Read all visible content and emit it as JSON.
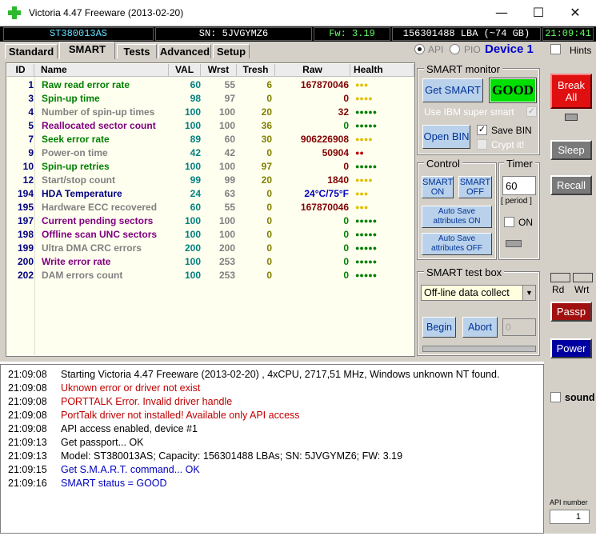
{
  "window": {
    "title": "Victoria 4.47  Freeware (2013-02-20)",
    "minimize": "—",
    "maximize": "☐",
    "close": "✕"
  },
  "infobar": {
    "model": "ST380013AS",
    "serial": "SN: 5JVGYMZ6",
    "firmware": "Fw: 3.19",
    "lba": "156301488 LBA (~74 GB)",
    "clock": "21:09:41"
  },
  "tabs": [
    "Standard",
    "SMART",
    "Tests",
    "Advanced",
    "Setup"
  ],
  "api_pio": {
    "api": "API",
    "pio": "PIO",
    "device": "Device 1",
    "hints": "Hints"
  },
  "smart_table": {
    "headers": [
      "ID",
      "Name",
      "VAL",
      "Wrst",
      "Tresh",
      "Raw",
      "Health"
    ],
    "rows": [
      {
        "id": "1",
        "name": "Raw read error rate",
        "val": "60",
        "wrst": "55",
        "tresh": "6",
        "raw": "167870046",
        "health": "●●●",
        "name_color": "#008000",
        "raw_color": "#800000",
        "health_color": "#e0c000"
      },
      {
        "id": "3",
        "name": "Spin-up time",
        "val": "98",
        "wrst": "97",
        "tresh": "0",
        "raw": "0",
        "health": "●●●●",
        "name_color": "#008000",
        "raw_color": "#800000",
        "health_color": "#e0c000"
      },
      {
        "id": "4",
        "name": "Number of spin-up times",
        "val": "100",
        "wrst": "100",
        "tresh": "20",
        "raw": "32",
        "health": "●●●●●",
        "name_color": "#808080",
        "raw_color": "#800000",
        "health_color": "#008000"
      },
      {
        "id": "5",
        "name": "Reallocated sector count",
        "val": "100",
        "wrst": "100",
        "tresh": "36",
        "raw": "0",
        "health": "●●●●●",
        "name_color": "#800080",
        "raw_color": "#008000",
        "health_color": "#008000"
      },
      {
        "id": "7",
        "name": "Seek error rate",
        "val": "89",
        "wrst": "60",
        "tresh": "30",
        "raw": "906226908",
        "health": "●●●●",
        "name_color": "#008000",
        "raw_color": "#800000",
        "health_color": "#e0c000"
      },
      {
        "id": "9",
        "name": "Power-on time",
        "val": "42",
        "wrst": "42",
        "tresh": "0",
        "raw": "50904",
        "health": "●●",
        "name_color": "#808080",
        "raw_color": "#800000",
        "health_color": "#c00000"
      },
      {
        "id": "10",
        "name": "Spin-up retries",
        "val": "100",
        "wrst": "100",
        "tresh": "97",
        "raw": "0",
        "health": "●●●●●",
        "name_color": "#008000",
        "raw_color": "#800000",
        "health_color": "#008000"
      },
      {
        "id": "12",
        "name": "Start/stop count",
        "val": "99",
        "wrst": "99",
        "tresh": "20",
        "raw": "1840",
        "health": "●●●●",
        "name_color": "#808080",
        "raw_color": "#800000",
        "health_color": "#e0c000"
      },
      {
        "id": "194",
        "name": "HDA Temperature",
        "val": "24",
        "wrst": "63",
        "tresh": "0",
        "raw": "24°C/75°F",
        "health": "●●●",
        "name_color": "#000080",
        "raw_color": "#0000c0",
        "health_color": "#e0c000"
      },
      {
        "id": "195",
        "name": "Hardware ECC recovered",
        "val": "60",
        "wrst": "55",
        "tresh": "0",
        "raw": "167870046",
        "health": "●●●",
        "name_color": "#808080",
        "raw_color": "#800000",
        "health_color": "#e0c000"
      },
      {
        "id": "197",
        "name": "Current pending sectors",
        "val": "100",
        "wrst": "100",
        "tresh": "0",
        "raw": "0",
        "health": "●●●●●",
        "name_color": "#800080",
        "raw_color": "#008000",
        "health_color": "#008000"
      },
      {
        "id": "198",
        "name": "Offline scan UNC sectors",
        "val": "100",
        "wrst": "100",
        "tresh": "0",
        "raw": "0",
        "health": "●●●●●",
        "name_color": "#800080",
        "raw_color": "#008000",
        "health_color": "#008000"
      },
      {
        "id": "199",
        "name": "Ultra DMA CRC errors",
        "val": "200",
        "wrst": "200",
        "tresh": "0",
        "raw": "0",
        "health": "●●●●●",
        "name_color": "#808080",
        "raw_color": "#008000",
        "health_color": "#008000"
      },
      {
        "id": "200",
        "name": "Write error rate",
        "val": "100",
        "wrst": "253",
        "tresh": "0",
        "raw": "0",
        "health": "●●●●●",
        "name_color": "#800080",
        "raw_color": "#008000",
        "health_color": "#008000"
      },
      {
        "id": "202",
        "name": "DAM errors count",
        "val": "100",
        "wrst": "253",
        "tresh": "0",
        "raw": "0",
        "health": "●●●●●",
        "name_color": "#808080",
        "raw_color": "#008000",
        "health_color": "#008000"
      }
    ]
  },
  "smart_monitor": {
    "title": "SMART monitor",
    "get_smart": "Get SMART",
    "status": "GOOD",
    "use_ibm": "Use IBM super smart",
    "open_bin": "Open BIN",
    "save_bin": "Save BIN",
    "crypt_it": "Crypt it!"
  },
  "control": {
    "title": "Control",
    "smart_on": "SMART ON",
    "smart_off": "SMART OFF",
    "autosave_on": "Auto Save attributes ON",
    "autosave_off": "Auto Save attributes OFF"
  },
  "timer": {
    "title": "Timer",
    "value": "60",
    "period": "[ period ]",
    "on": "ON"
  },
  "test_box": {
    "title": "SMART test box",
    "selected": "Off-line data collect",
    "begin": "Begin",
    "abort": "Abort",
    "value": "0"
  },
  "sidebar": {
    "break_all": "Break All",
    "sleep": "Sleep",
    "recall": "Recall",
    "rd": "Rd",
    "wrt": "Wrt",
    "passp": "Passp",
    "power": "Power",
    "sound": "sound",
    "api_number": "API number",
    "api_value": "1"
  },
  "log": [
    {
      "time": "21:09:08",
      "text": "Starting Victoria 4.47  Freeware (2013-02-20) , 4xCPU, 2717,51 MHz, Windows unknown NT found.",
      "color": "#000000"
    },
    {
      "time": "21:09:08",
      "text": "Uknown error or driver not exist",
      "color": "#c00000"
    },
    {
      "time": "21:09:08",
      "text": "PORTTALK Error. Invalid driver handle",
      "color": "#c00000"
    },
    {
      "time": "21:09:08",
      "text": "PortTalk driver not installed! Available only API access",
      "color": "#c00000"
    },
    {
      "time": "21:09:08",
      "text": "API access enabled, device #1",
      "color": "#000000"
    },
    {
      "time": "21:09:13",
      "text": "Get passport... OK",
      "color": "#000000"
    },
    {
      "time": "21:09:13",
      "text": "Model: ST380013AS; Capacity: 156301488 LBAs; SN: 5JVGYMZ6; FW: 3.19",
      "color": "#000000"
    },
    {
      "time": "21:09:15",
      "text": "Get S.M.A.R.T. command... OK",
      "color": "#0000c0"
    },
    {
      "time": "21:09:16",
      "text": "SMART status = GOOD",
      "color": "#0000c0"
    }
  ]
}
